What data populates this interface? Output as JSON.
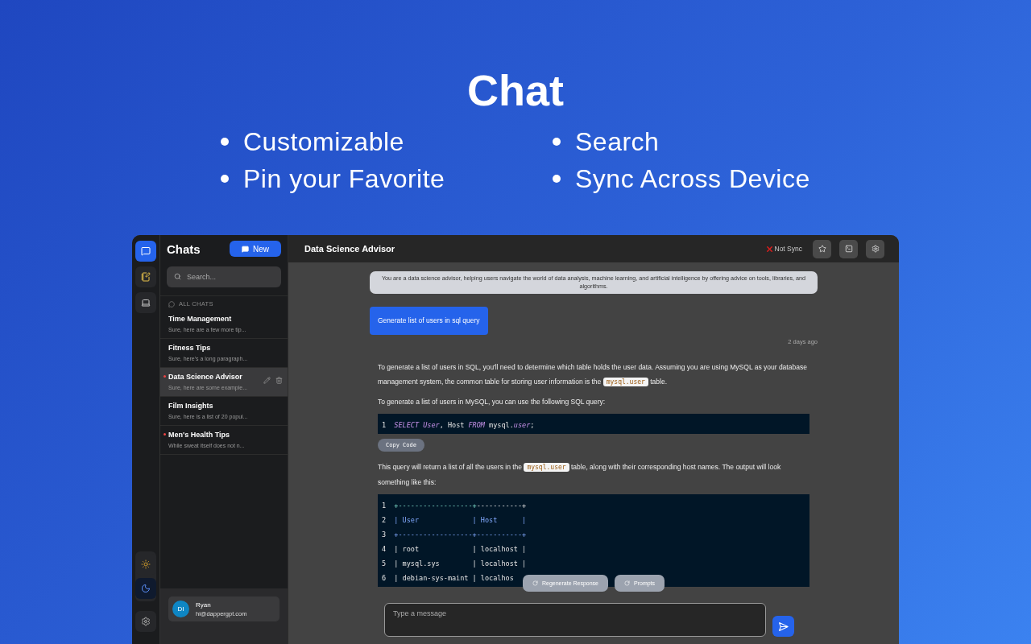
{
  "hero": {
    "title": "Chat",
    "features": [
      "Customizable",
      "Search",
      "Pin your Favorite",
      "Sync Across Device"
    ]
  },
  "rail": {
    "top": [
      {
        "kind": "chat",
        "selected": true
      },
      {
        "kind": "notes",
        "selected": false
      },
      {
        "kind": "laptop",
        "selected": false
      }
    ],
    "theme": [
      {
        "kind": "sun",
        "selected": false
      },
      {
        "kind": "moon",
        "selected": true
      }
    ]
  },
  "sidebar": {
    "title": "Chats",
    "new_button": "New",
    "search": {
      "placeholder": "Search..."
    },
    "section": "ALL CHATS",
    "chats": [
      {
        "title": "Time Management",
        "preview": "Sure, here are a few more tip...",
        "unread": false,
        "selected": false
      },
      {
        "title": "Fitness Tips",
        "preview": "Sure, here's a long paragraph...",
        "unread": false,
        "selected": false
      },
      {
        "title": "Data Science Advisor",
        "preview": "Sure, here are some example...",
        "unread": true,
        "selected": true
      },
      {
        "title": "Film Insights",
        "preview": "Sure, here is a list of 20 popul...",
        "unread": false,
        "selected": false
      },
      {
        "title": "Men's Health Tips",
        "preview": "While sweat itself does not n...",
        "unread": true,
        "selected": false
      }
    ],
    "user": {
      "initials": "DI",
      "name": "Ryan",
      "email": "hi@dappergpt.com"
    }
  },
  "header": {
    "title": "Data Science Advisor",
    "sync": "Not Sync",
    "synced": false
  },
  "messages": [
    {
      "kind": "system",
      "text": "You are a data science advisor, helping users navigate the world of data analysis, machine learning, and artificial intelligence by offering advice on tools, libraries, and algorithms."
    },
    {
      "kind": "user",
      "text": "Generate list of users in sql query",
      "time": "2 days ago"
    },
    {
      "kind": "assistant",
      "blocks": [
        {
          "kind": "paragraph",
          "parts": [
            {
              "kind": "text",
              "text": "To generate a list of users in SQL, you'll need to determine which table holds the user data. Assuming you are using MySQL as your database management system, the common table for storing user information is the "
            },
            {
              "kind": "code",
              "text": "mysql.user"
            },
            {
              "kind": "text",
              "text": " table."
            }
          ]
        },
        {
          "kind": "paragraph",
          "parts": [
            {
              "kind": "text",
              "text": "To generate a list of users in MySQL, you can use the following SQL query:"
            }
          ]
        },
        {
          "kind": "code",
          "copy": "Copy Code",
          "lines": [
            {
              "number": "1",
              "tokens": [
                {
                  "kind": "keyword",
                  "text": "SELECT "
                },
                {
                  "kind": "ident",
                  "text": "User"
                },
                {
                  "kind": "plain",
                  "text": ", Host "
                },
                {
                  "kind": "keyword",
                  "text": "FROM"
                },
                {
                  "kind": "plain",
                  "text": " mysql."
                },
                {
                  "kind": "ident",
                  "text": "user"
                },
                {
                  "kind": "plain",
                  "text": ";"
                }
              ]
            }
          ]
        },
        {
          "kind": "paragraph",
          "parts": [
            {
              "kind": "text",
              "text": "This query will return a list of all the users in the "
            },
            {
              "kind": "code",
              "text": "mysql.user"
            },
            {
              "kind": "text",
              "text": " table, along with their corresponding host names. The output will look something like this:"
            }
          ]
        },
        {
          "kind": "code",
          "lines": [
            {
              "number": "1",
              "tokens": [
                {
                  "kind": "green",
                  "text": "+------------------+"
                },
                {
                  "kind": "plain",
                  "text": "-----------+"
                }
              ]
            },
            {
              "number": "2",
              "tokens": [
                {
                  "kind": "blue",
                  "text": "| User             | Host      |"
                }
              ]
            },
            {
              "number": "3",
              "tokens": [
                {
                  "kind": "blue",
                  "text": "+------------------+-----------+"
                }
              ]
            },
            {
              "number": "4",
              "tokens": [
                {
                  "kind": "plain",
                  "text": "| root             | localhost |"
                }
              ]
            },
            {
              "number": "5",
              "tokens": [
                {
                  "kind": "plain",
                  "text": "| mysql.sys        | localhost |"
                }
              ]
            },
            {
              "number": "6",
              "tokens": [
                {
                  "kind": "plain",
                  "text": "| debian-sys-maint | localhos"
                }
              ]
            }
          ]
        }
      ]
    }
  ],
  "actions": [
    "Regenerate Response",
    "Prompts"
  ],
  "composer": {
    "placeholder": "Type a message"
  }
}
